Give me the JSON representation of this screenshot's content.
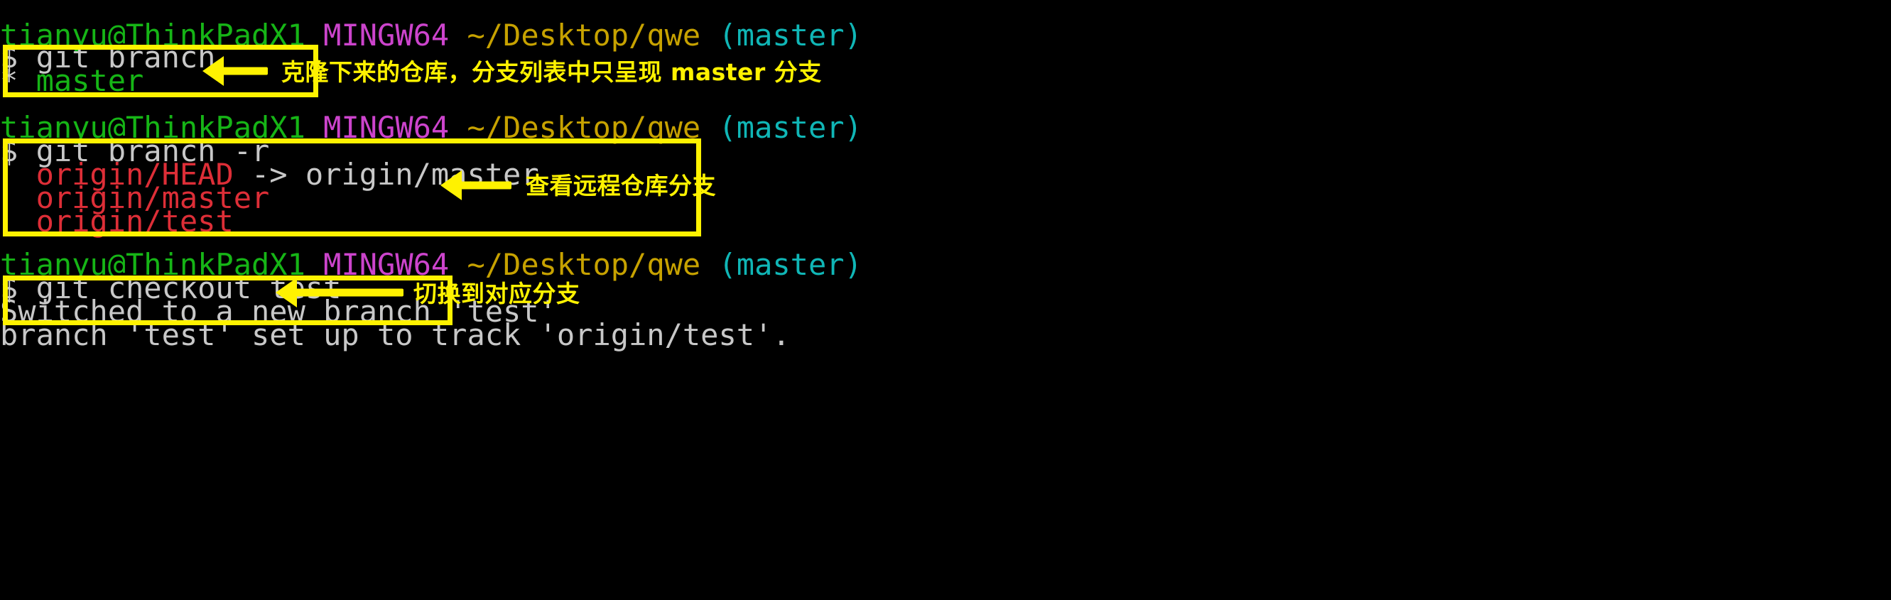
{
  "terminal": {
    "background": "#000000",
    "colors": {
      "user_host": "#16b516",
      "shell_name": "#cc44cc",
      "path": "#c7a200",
      "git_branch": "#10b6b6",
      "output": "#c8c8c8",
      "local_branch": "#16b516",
      "remote_branch": "#dd2e37",
      "highlight": "#fff200"
    },
    "prompt": {
      "user_host": "tianyu@ThinkPadX1",
      "shell": "MINGW64",
      "path": "~/Desktop/qwe",
      "branch": "(master)",
      "symbol": "$"
    },
    "blocks": [
      {
        "id": "block-1",
        "command": "$ git branch",
        "output_lines": [
          {
            "prefix": "* ",
            "name": "master",
            "style": "local"
          }
        ]
      },
      {
        "id": "block-2",
        "command": "$ git branch -r",
        "output_lines": [
          {
            "prefix": "  ",
            "name": "origin/HEAD",
            "suffix": " -> origin/master",
            "style": "remote"
          },
          {
            "prefix": "  ",
            "name": "origin/master",
            "suffix": "",
            "style": "remote"
          },
          {
            "prefix": "  ",
            "name": "origin/test",
            "suffix": "",
            "style": "remote"
          }
        ]
      },
      {
        "id": "block-3",
        "command": "$ git checkout test",
        "output_lines": [
          {
            "text": "Switched to a new branch 'test'"
          },
          {
            "text": "branch 'test' set up to track 'origin/test'."
          }
        ]
      }
    ]
  },
  "annotations": [
    {
      "id": "annot-1",
      "text": "克隆下来的仓库，分支列表中只呈现 master 分支"
    },
    {
      "id": "annot-2",
      "text": "查看远程仓库分支"
    },
    {
      "id": "annot-3",
      "text": "切换到对应分支"
    }
  ]
}
